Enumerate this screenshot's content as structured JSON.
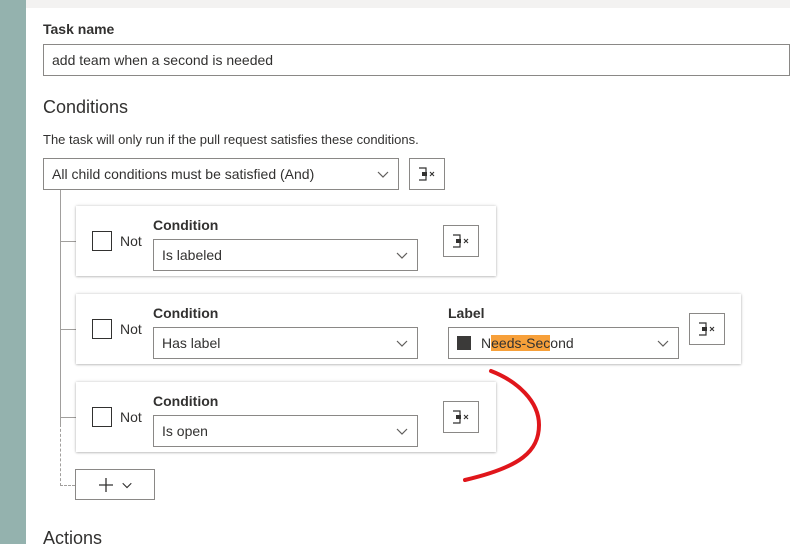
{
  "task": {
    "name_label": "Task name",
    "name_value": "add team when a second is needed"
  },
  "conditions": {
    "title": "Conditions",
    "description": "The task will only run if the pull request satisfies these conditions.",
    "group_operator": "All child conditions must be satisfied (And)",
    "items": [
      {
        "not_label": "Not",
        "not_checked": false,
        "condition_label": "Condition",
        "condition_value": "Is labeled"
      },
      {
        "not_label": "Not",
        "not_checked": false,
        "condition_label": "Condition",
        "condition_value": "Has label",
        "label_field_label": "Label",
        "label_value_pre": "N",
        "label_value_hl1": "eeds-Sec",
        "label_value_post": "ond",
        "label_color": "#3b3a39"
      },
      {
        "not_label": "Not",
        "not_checked": false,
        "condition_label": "Condition",
        "condition_value": "Is open"
      }
    ]
  },
  "actions": {
    "title": "Actions"
  },
  "icons": {
    "remove": "remove-condition-icon",
    "chevron": "chevron-down-icon",
    "add": "plus-icon"
  },
  "colors": {
    "left_bar": "#94b2ae",
    "highlight": "#f7a03a",
    "annotation": "#e0161b"
  }
}
